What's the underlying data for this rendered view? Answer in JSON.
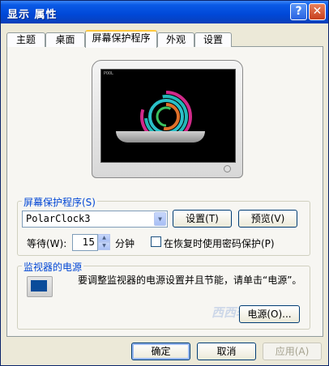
{
  "window": {
    "title": "显示 属性",
    "help_glyph": "?",
    "close_glyph": "✕"
  },
  "tabs": [
    "主题",
    "桌面",
    "屏幕保护程序",
    "外观",
    "设置"
  ],
  "active_tab": "屏幕保护程序",
  "preview": {
    "screen_label": "POOL"
  },
  "screensaver": {
    "group_label": "屏幕保护程序(S)",
    "selected": "PolarClock3",
    "settings_label": "设置(T)",
    "preview_label": "预览(V)",
    "wait_label": "等待(W):",
    "wait_value": "15",
    "wait_unit": "分钟",
    "password_label": "在恢复时使用密码保护(P)",
    "password_checked": false
  },
  "power": {
    "group_label": "监视器的电源",
    "description": "要调整监视器的电源设置并且节能，请单击“电源”。",
    "power_button": "电源(O)..."
  },
  "footer": {
    "ok": "确定",
    "cancel": "取消",
    "apply": "应用(A)"
  },
  "watermark": "西西软件园"
}
